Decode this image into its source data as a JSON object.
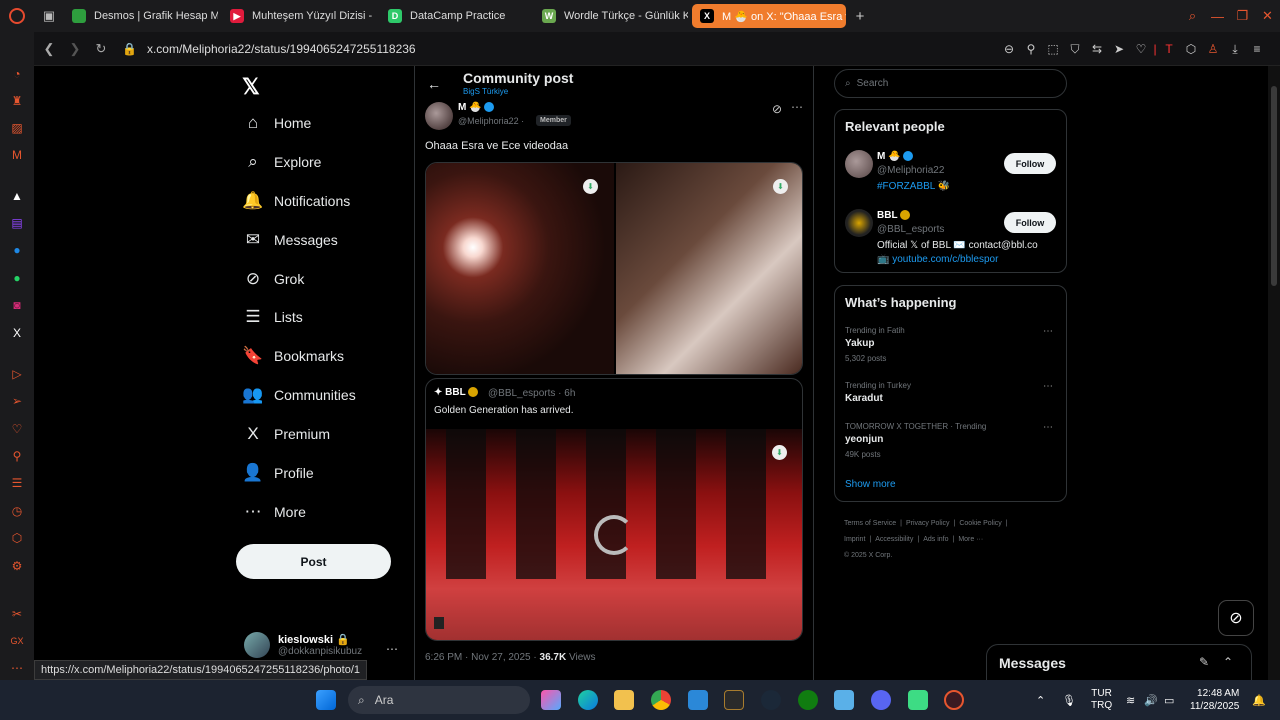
{
  "browser": {
    "tabs": [
      {
        "label": "Desmos | Grafik Hesap M",
        "fav_color": "#2e9e3e",
        "fav_text": ""
      },
      {
        "label": "Muhteşem Yüzyıl Dizisi -",
        "fav_color": "#e01b3c",
        "fav_text": "▶"
      },
      {
        "label": "DataCamp Practice",
        "fav_color": "#2ec96a",
        "fav_text": "D"
      },
      {
        "label": "Wordle Türkçe - Günlük K",
        "fav_color": "#6aa84f",
        "fav_text": "W"
      },
      {
        "label": "M 🐣 on X: \"Ohaaa Esra v",
        "fav_color": "#000000",
        "fav_text": "X"
      }
    ],
    "url": "x.com/Meliphoria22/status/1994065247255118236",
    "status_url": "https://x.com/Meliphoria22/status/1994065247255118236/photo/1"
  },
  "nav": {
    "items": [
      {
        "icon": "⌂",
        "label": "Home"
      },
      {
        "icon": "⌕",
        "label": "Explore"
      },
      {
        "icon": "🔔",
        "label": "Notifications"
      },
      {
        "icon": "✉",
        "label": "Messages"
      },
      {
        "icon": "⊘",
        "label": "Grok"
      },
      {
        "icon": "☰",
        "label": "Lists"
      },
      {
        "icon": "🔖",
        "label": "Bookmarks"
      },
      {
        "icon": "👥",
        "label": "Communities"
      },
      {
        "icon": "X",
        "label": "Premium"
      },
      {
        "icon": "👤",
        "label": "Profile"
      },
      {
        "icon": "⋯",
        "label": "More"
      }
    ],
    "post_label": "Post",
    "account_name": "kieslowski 🔒",
    "account_handle": "@dokkanpisikubuz"
  },
  "post": {
    "header_title": "Community post",
    "header_sub": "BigS Türkiye",
    "author_name": "M 🐣",
    "author_handle": "@Meliphoria22 ·",
    "member_badge": "Member",
    "text": "Ohaaa Esra ve Ece videodaa",
    "quote_name": "BBL",
    "quote_handle": "@BBL_esports · 6h",
    "quote_text": "Golden Generation has arrived.",
    "time": "6:26 PM · Nov 27, 2025 ·",
    "views": "36.7K",
    "views_label": "Views"
  },
  "right": {
    "search_placeholder": "Search",
    "relevant_title": "Relevant people",
    "people": [
      {
        "name": "M 🐣",
        "handle": "@Meliphoria22",
        "extra": "#FORZABBL 🐝",
        "bio": "",
        "follow": "Follow"
      },
      {
        "name": "BBL",
        "handle": "@BBL_esports",
        "extra": "📺 youtube.com/c/bblespor",
        "bio": "Official 𝕏 of BBL ✉️ contact@bbl.co",
        "follow": "Follow"
      }
    ],
    "happening_title": "What’s happening",
    "trends": [
      {
        "context": "Trending in Fatih",
        "name": "Yakup",
        "posts": "5,302 posts"
      },
      {
        "context": "Trending in Turkey",
        "name": "Karadut",
        "posts": ""
      },
      {
        "context": "TOMORROW X TOGETHER · Trending",
        "name": "yeonjun",
        "posts": "49K posts"
      }
    ],
    "show_more": "Show more",
    "footer": [
      "Terms of Service",
      "|",
      "Privacy Policy",
      "|",
      "Cookie Policy",
      "|",
      "Imprint",
      "|",
      "Accessibility",
      "|",
      "Ads info",
      "|",
      "More ···",
      "© 2025 X Corp."
    ],
    "messages_title": "Messages"
  },
  "taskbar": {
    "search_label": "Ara",
    "lang_top": "TUR",
    "lang_bottom": "TRQ",
    "time": "12:48 AM",
    "date": "11/28/2025"
  }
}
